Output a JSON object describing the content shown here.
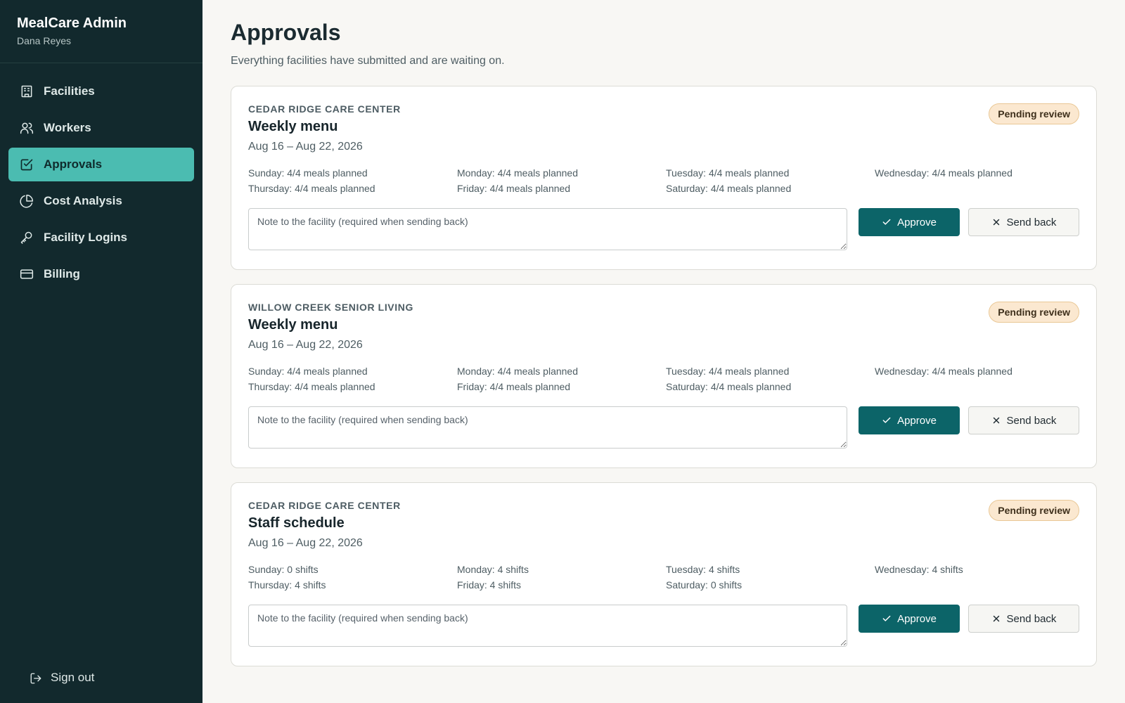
{
  "sidebar": {
    "brand_title": "MealCare Admin",
    "user_name": "Dana Reyes",
    "items": [
      {
        "label": "Facilities",
        "icon": "building-icon"
      },
      {
        "label": "Workers",
        "icon": "users-icon"
      },
      {
        "label": "Approvals",
        "icon": "check-square-icon",
        "active": true
      },
      {
        "label": "Cost Analysis",
        "icon": "pie-chart-icon"
      },
      {
        "label": "Facility Logins",
        "icon": "key-icon"
      },
      {
        "label": "Billing",
        "icon": "credit-card-icon"
      }
    ],
    "signout_label": "Sign out"
  },
  "main": {
    "title": "Approvals",
    "subtitle": "Everything facilities have submitted and are waiting on."
  },
  "note_placeholder": "Note to the facility (required when sending back)",
  "approve_label": "Approve",
  "send_back_label": "Send back",
  "cards": [
    {
      "facility": "CEDAR RIDGE CARE CENTER",
      "title": "Weekly menu",
      "range": "Aug 16 – Aug 22, 2026",
      "status": "Pending review",
      "days": [
        "Sunday: 4/4 meals planned",
        "Monday: 4/4 meals planned",
        "Tuesday: 4/4 meals planned",
        "Wednesday: 4/4 meals planned",
        "Thursday: 4/4 meals planned",
        "Friday: 4/4 meals planned",
        "Saturday: 4/4 meals planned"
      ]
    },
    {
      "facility": "WILLOW CREEK SENIOR LIVING",
      "title": "Weekly menu",
      "range": "Aug 16 – Aug 22, 2026",
      "status": "Pending review",
      "days": [
        "Sunday: 4/4 meals planned",
        "Monday: 4/4 meals planned",
        "Tuesday: 4/4 meals planned",
        "Wednesday: 4/4 meals planned",
        "Thursday: 4/4 meals planned",
        "Friday: 4/4 meals planned",
        "Saturday: 4/4 meals planned"
      ]
    },
    {
      "facility": "CEDAR RIDGE CARE CENTER",
      "title": "Staff schedule",
      "range": "Aug 16 – Aug 22, 2026",
      "status": "Pending review",
      "days": [
        "Sunday: 0 shifts",
        "Monday: 4 shifts",
        "Tuesday: 4 shifts",
        "Wednesday: 4 shifts",
        "Thursday: 4 shifts",
        "Friday: 4 shifts",
        "Saturday: 0 shifts"
      ]
    }
  ],
  "colors": {
    "sidebar_bg": "#12292d",
    "active_nav": "#4bbcb1",
    "primary": "#0c6468",
    "badge_bg": "#fbe8d0"
  }
}
